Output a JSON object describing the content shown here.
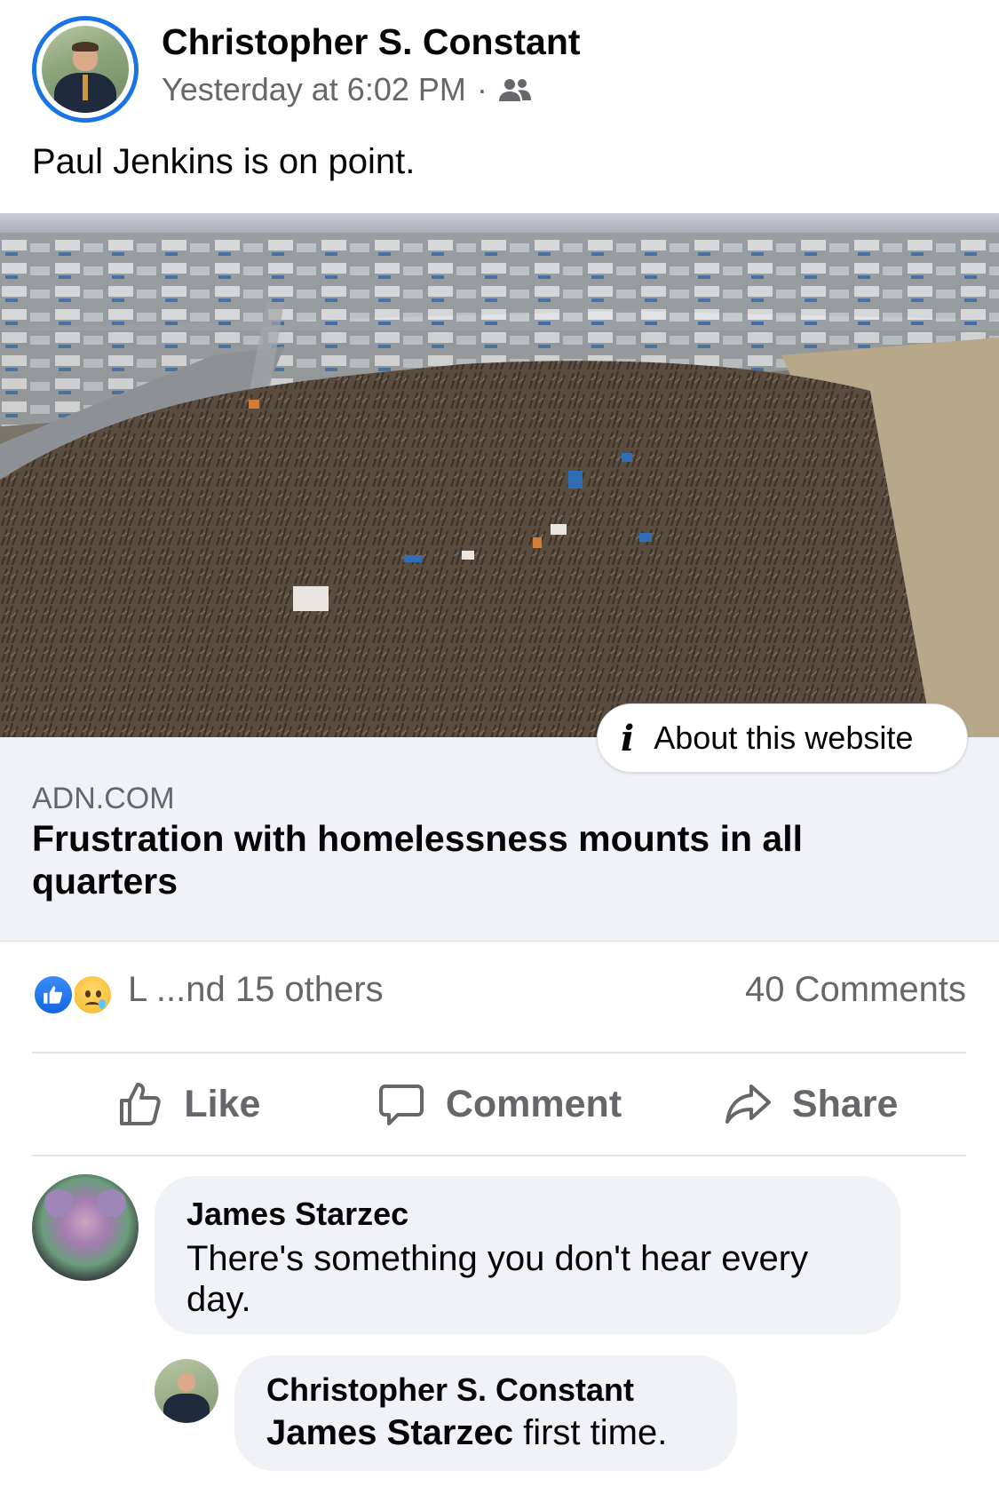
{
  "post": {
    "author": "Christopher S. Constant",
    "timestamp": "Yesterday at 6:02 PM",
    "separator": "·",
    "audience_icon": "friends-icon",
    "text": "Paul Jenkins is on point."
  },
  "link_preview": {
    "about_label": "About this website",
    "domain": "ADN.COM",
    "title": "Frustration with homelessness mounts in all quarters"
  },
  "reactions": {
    "icons": [
      "like-icon",
      "sad-icon"
    ],
    "summary_text": "L            ...nd 15 others",
    "comments_count": "40 Comments"
  },
  "actions": {
    "like": "Like",
    "comment": "Comment",
    "share": "Share"
  },
  "comments": [
    {
      "author": "James Starzec",
      "text": "There's something you don't hear every day."
    },
    {
      "author": "Christopher S. Constant",
      "mention": "James Starzec",
      "text": " first time."
    }
  ],
  "colors": {
    "accent": "#1b74e4",
    "secondary_text": "#65676b",
    "bubble_bg": "#f0f2f5"
  }
}
